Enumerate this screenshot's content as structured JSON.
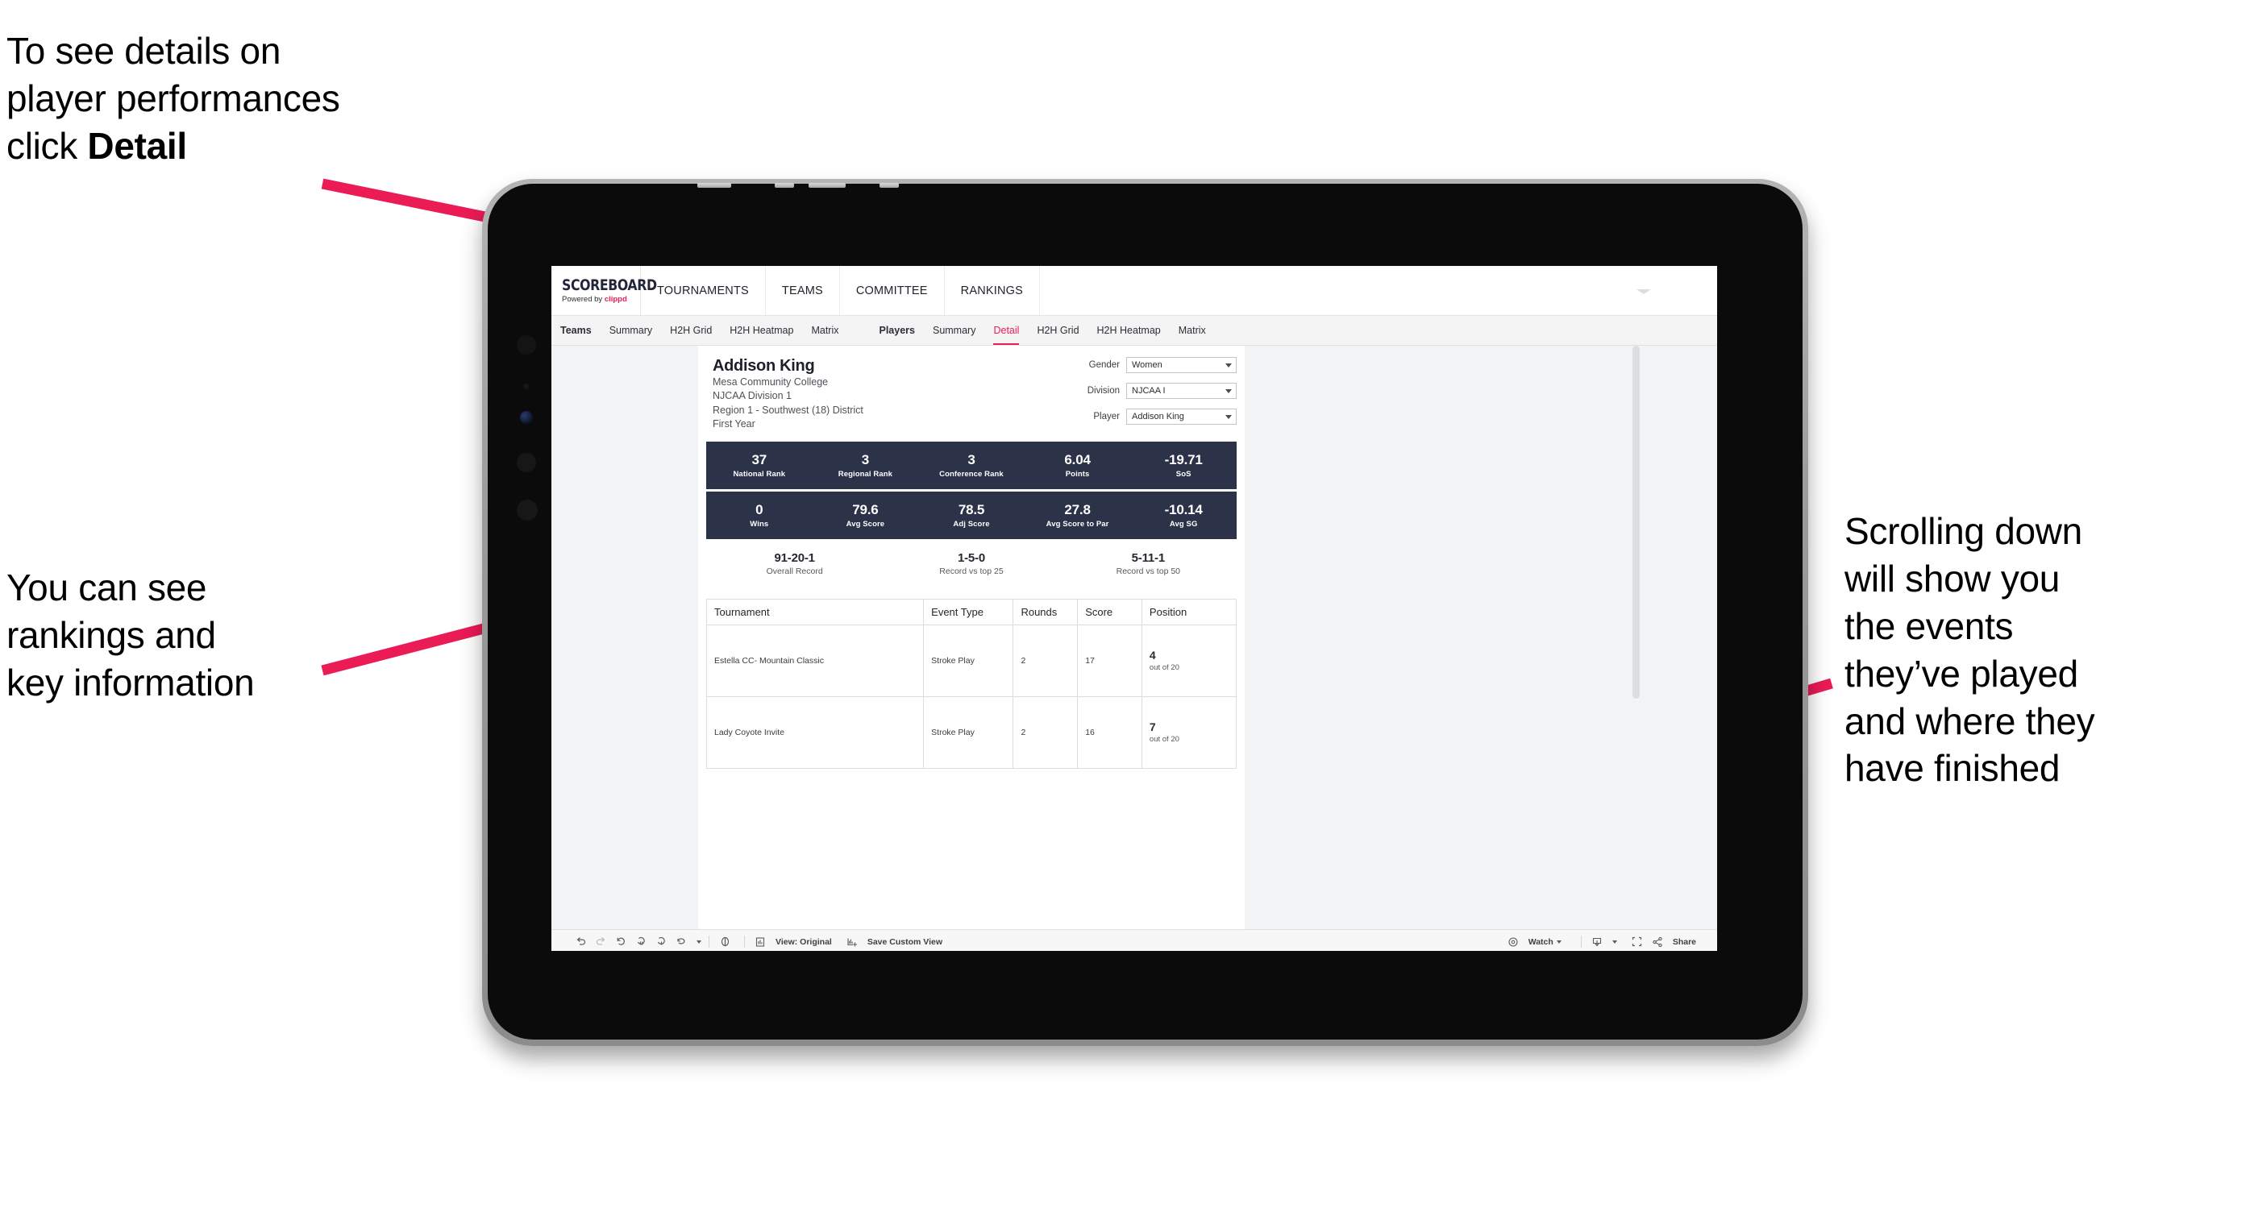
{
  "annotations": {
    "top_left": "To see details on\nplayer performances\nclick ",
    "top_left_bold": "Detail",
    "left": "You can see\nrankings and\nkey information",
    "right": "Scrolling down\nwill show you\nthe events\nthey’ve played\nand where they\nhave finished"
  },
  "colors": {
    "accent_pink": "#ea1b55",
    "arrow_pink": "#ea1b55",
    "stat_band_navy": "#2c3247",
    "device_frame": "#9a9a9a",
    "viz_background": "#eceef1"
  },
  "app": {
    "logo_title": "SCOREBOARD",
    "logo_sub_prefix": "Powered by ",
    "logo_sub_brand": "clippd",
    "main_nav": [
      "TOURNAMENTS",
      "TEAMS",
      "COMMITTEE",
      "RANKINGS"
    ],
    "sub_nav": {
      "teams_group": [
        "Teams",
        "Summary",
        "H2H Grid",
        "H2H Heatmap",
        "Matrix"
      ],
      "players_group": [
        "Players",
        "Summary",
        "Detail",
        "H2H Grid",
        "H2H Heatmap",
        "Matrix"
      ],
      "active": "Detail"
    }
  },
  "player": {
    "name": "Addison King",
    "school": "Mesa Community College",
    "division": "NJCAA Division 1",
    "region": "Region 1 - Southwest (18) District",
    "year": "First Year"
  },
  "filters": [
    {
      "label": "Gender",
      "value": "Women"
    },
    {
      "label": "Division",
      "value": "NJCAA I"
    },
    {
      "label": "Player",
      "value": "Addison King"
    }
  ],
  "stats_band_1": [
    {
      "value": "37",
      "label": "National Rank"
    },
    {
      "value": "3",
      "label": "Regional Rank"
    },
    {
      "value": "3",
      "label": "Conference Rank"
    },
    {
      "value": "6.04",
      "label": "Points"
    },
    {
      "value": "-19.71",
      "label": "SoS"
    }
  ],
  "stats_band_2": [
    {
      "value": "0",
      "label": "Wins"
    },
    {
      "value": "79.6",
      "label": "Avg Score"
    },
    {
      "value": "78.5",
      "label": "Adj Score"
    },
    {
      "value": "27.8",
      "label": "Avg Score to Par"
    },
    {
      "value": "-10.14",
      "label": "Avg SG"
    }
  ],
  "records": [
    {
      "value": "91-20-1",
      "label": "Overall Record"
    },
    {
      "value": "1-5-0",
      "label": "Record vs top 25"
    },
    {
      "value": "5-11-1",
      "label": "Record vs top 50"
    }
  ],
  "events_table": {
    "headers": [
      "Tournament",
      "Event Type",
      "Rounds",
      "Score",
      "Position"
    ],
    "rows": [
      {
        "tournament": "Estella CC- Mountain Classic",
        "event_type": "Stroke Play",
        "rounds": "2",
        "score": "17",
        "position": "4",
        "position_of": "out of 20"
      },
      {
        "tournament": "Lady Coyote Invite",
        "event_type": "Stroke Play",
        "rounds": "2",
        "score": "16",
        "position": "7",
        "position_of": "out of 20"
      }
    ]
  },
  "toolbar": {
    "view_original": "View: Original",
    "save_custom_view": "Save Custom View",
    "watch": "Watch",
    "share": "Share"
  }
}
